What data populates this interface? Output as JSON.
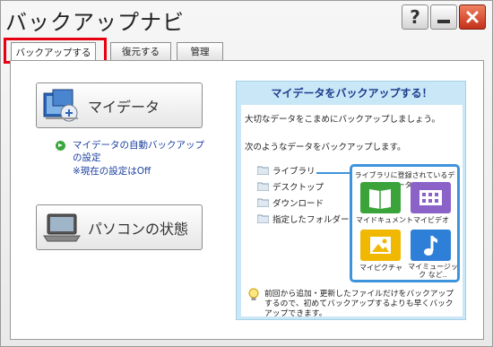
{
  "window": {
    "title": "バックアップナビ",
    "help_glyph": "?"
  },
  "tabs": [
    {
      "label": "バックアップする",
      "active": true
    },
    {
      "label": "復元する",
      "active": false
    },
    {
      "label": "管理",
      "active": false
    }
  ],
  "left": {
    "mydata_button": "マイデータ",
    "auto_backup_link": "マイデータの自動バックアップの設定",
    "current_setting": "※現在の設定はOff",
    "pc_state_button": "パソコンの状態"
  },
  "info": {
    "title": "マイデータをバックアップする！",
    "text1": "大切なデータをこまめにバックアップしましょう。",
    "text2": "次のようなデータをバックアップします。",
    "folders": [
      "ライブラリ",
      "デスクトップ",
      "ダウンロード",
      "指定したフォルダー"
    ],
    "library_box_title": "ライブラリに登録されているデータ",
    "library_items": [
      {
        "label": "マイドキュメント",
        "color": "#3aa33a"
      },
      {
        "label": "マイビデオ",
        "color": "#8a62c8"
      },
      {
        "label": "マイピクチャ",
        "color": "#f0b800"
      },
      {
        "label": "マイミュージック など..",
        "color": "#2e7fd8"
      }
    ],
    "hint": "前回から追加・更新したファイルだけをバックアップするので、初めてバックアップするよりも早くバックアップできます。"
  },
  "colors": {
    "highlight": "#e60012",
    "panel_accent": "#c9e7f7",
    "link": "#1b3fa0"
  }
}
